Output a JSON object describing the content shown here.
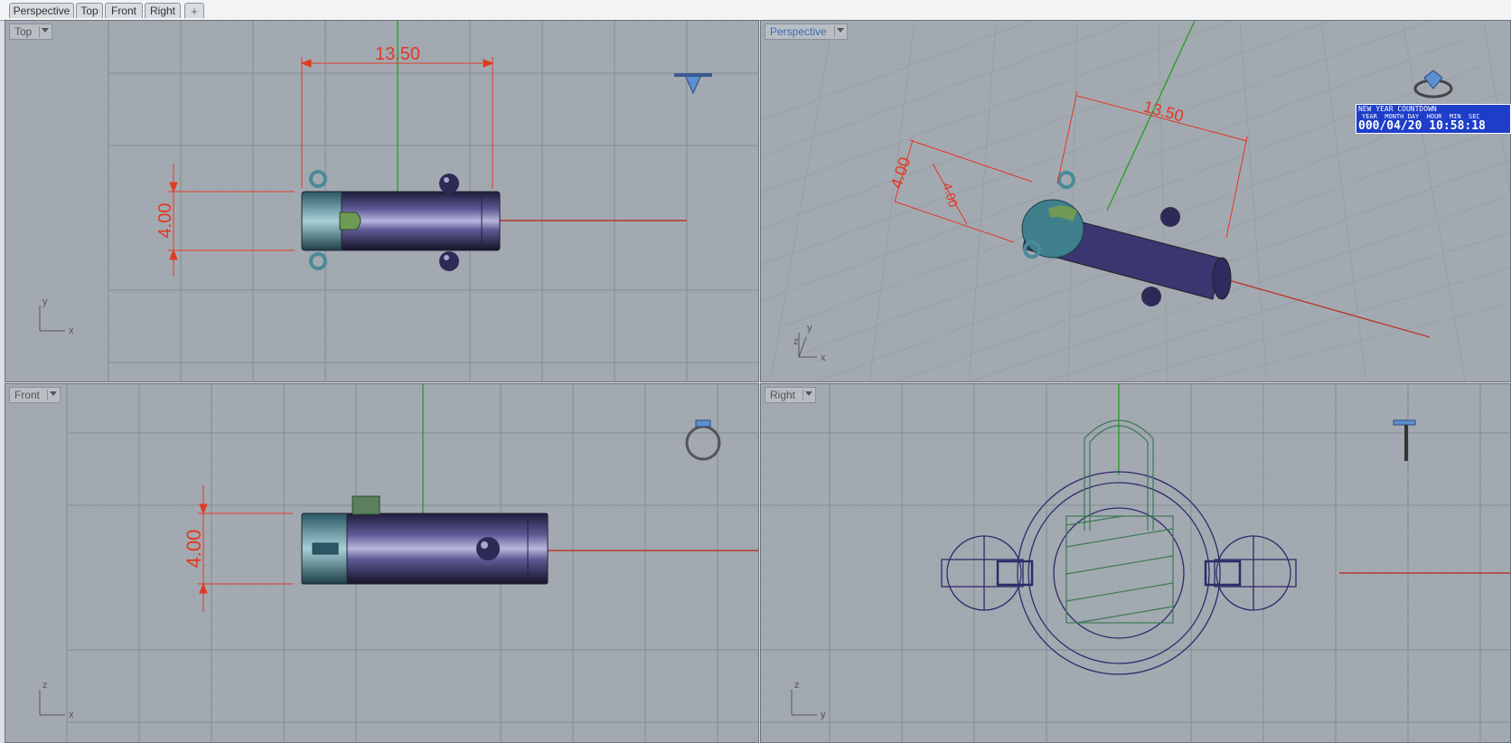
{
  "tabs": [
    {
      "label": "Perspective"
    },
    {
      "label": "Top"
    },
    {
      "label": "Front"
    },
    {
      "label": "Right"
    },
    {
      "label": "+"
    }
  ],
  "viewports": {
    "top": {
      "label": "Top",
      "dims": [
        "13.50",
        "4.00"
      ],
      "axis": {
        "v": "y",
        "h": "x"
      }
    },
    "perspective": {
      "label": "Perspective",
      "dims": [
        "13.50",
        "4.00",
        "4.00"
      ],
      "axis": {
        "v": "y",
        "h": "x",
        "z": "z"
      }
    },
    "front": {
      "label": "Front",
      "dims": [
        "4.00"
      ],
      "axis": {
        "v": "z",
        "h": "x"
      }
    },
    "right": {
      "label": "Right",
      "axis": {
        "v": "z",
        "h": "y"
      }
    }
  },
  "countdown": {
    "title": "NEW YEAR COUNTDOWN",
    "headers": "YEAR  MONTH DAY  HOUR  MIN  SEC",
    "value": "000/04/20 10:58:18"
  },
  "colors": {
    "viewport_bg": "#a3a9b1",
    "grid": "#959ba3",
    "dimension": "#e03a22",
    "x_axis": "#b83a2a",
    "y_axis": "#2aa02a",
    "body": "#3d3a6a",
    "cap": "#4a8a98",
    "active_label": "#3b6db3"
  }
}
